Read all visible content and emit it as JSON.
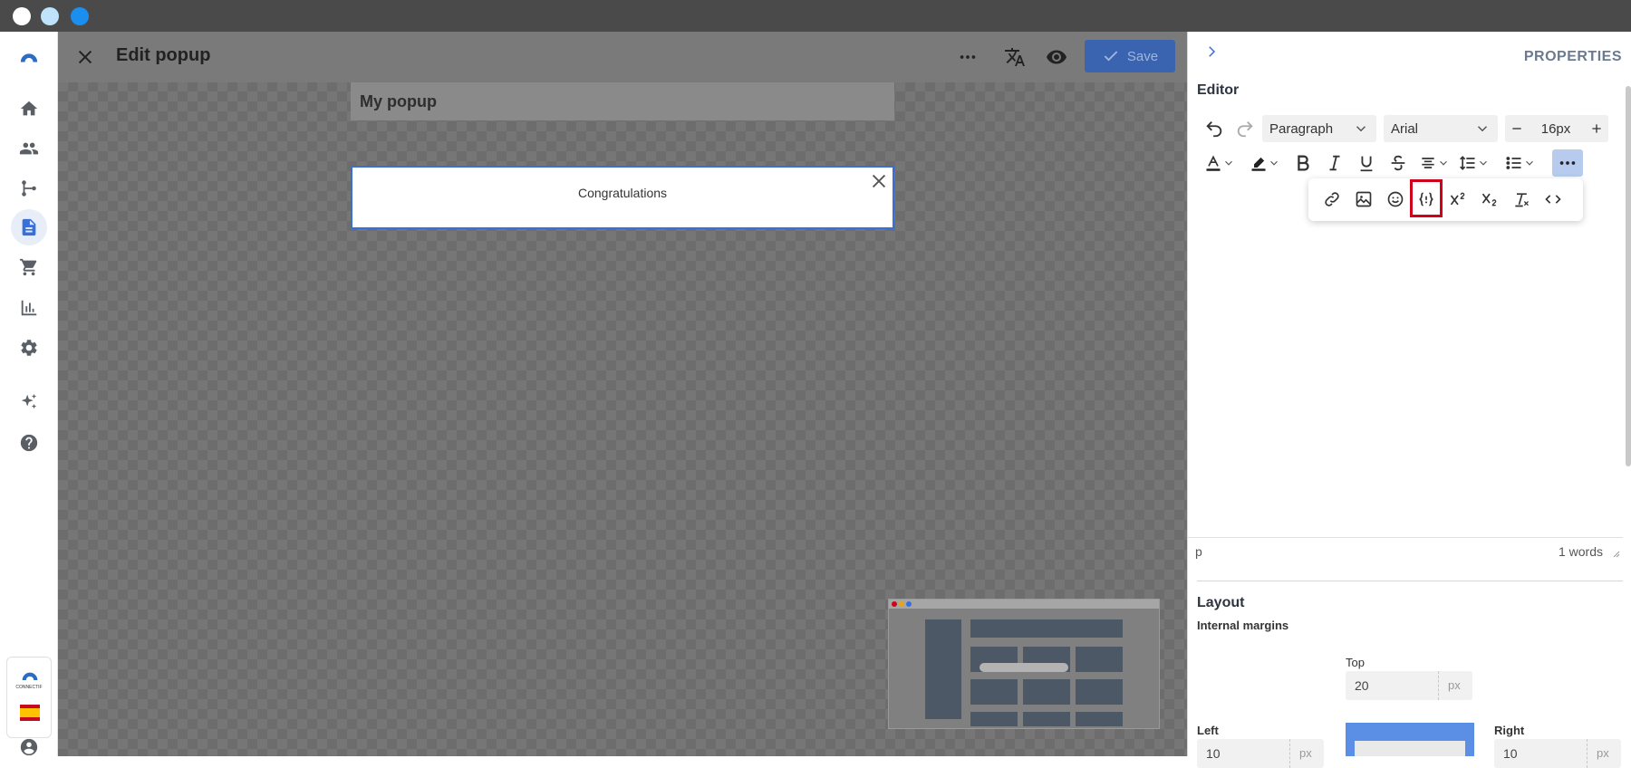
{
  "window": {
    "traffic_lights": [
      "#ffffff",
      "#bfe3fb",
      "#1b8ff0"
    ]
  },
  "left_nav": {
    "items": [
      {
        "icon": "logo-icon"
      },
      {
        "icon": "home-icon"
      },
      {
        "icon": "people-icon"
      },
      {
        "icon": "flow-icon"
      },
      {
        "icon": "document-icon",
        "active": true
      },
      {
        "icon": "cart-icon"
      },
      {
        "icon": "chart-icon"
      },
      {
        "icon": "gear-icon"
      },
      {
        "icon": "sparkle-icon"
      },
      {
        "icon": "help-icon"
      }
    ],
    "brand_badge_text": "CONNECTIF",
    "language_flag": "es"
  },
  "header": {
    "title": "Edit popup",
    "save_label": "Save"
  },
  "canvas": {
    "popup_header_title": "My popup",
    "popup_text": "Congratulations"
  },
  "panel": {
    "title": "PROPERTIES",
    "editor_section_title": "Editor",
    "block_format": "Paragraph",
    "font_family": "Arial",
    "font_size": "16px",
    "status_path": "p",
    "word_count": "1 words",
    "layout_section_title": "Layout",
    "internal_margins_label": "Internal margins",
    "margins": {
      "top_label": "Top",
      "top_value": "20",
      "left_label": "Left",
      "left_value": "10",
      "right_label": "Right",
      "right_value": "10",
      "unit": "px"
    }
  },
  "colors": {
    "accent": "#3a6fd8",
    "save_bg": "#3a63b0",
    "highlight": "#d0021b"
  }
}
